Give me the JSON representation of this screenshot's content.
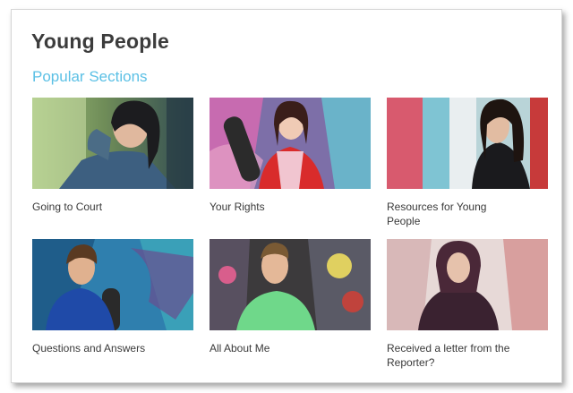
{
  "panel": {
    "title": "Young People",
    "subtitle": "Popular Sections"
  },
  "sections": [
    {
      "label": "Going to Court"
    },
    {
      "label": "Your Rights"
    },
    {
      "label": "Resources for Young People"
    },
    {
      "label": "Questions and Answers"
    },
    {
      "label": "All About Me"
    },
    {
      "label": "Received a letter from the Reporter?"
    }
  ],
  "colors": {
    "title": "#3c3c3c",
    "subtitle_accent": "#5bc0e5",
    "label": "#3a3a3a"
  }
}
